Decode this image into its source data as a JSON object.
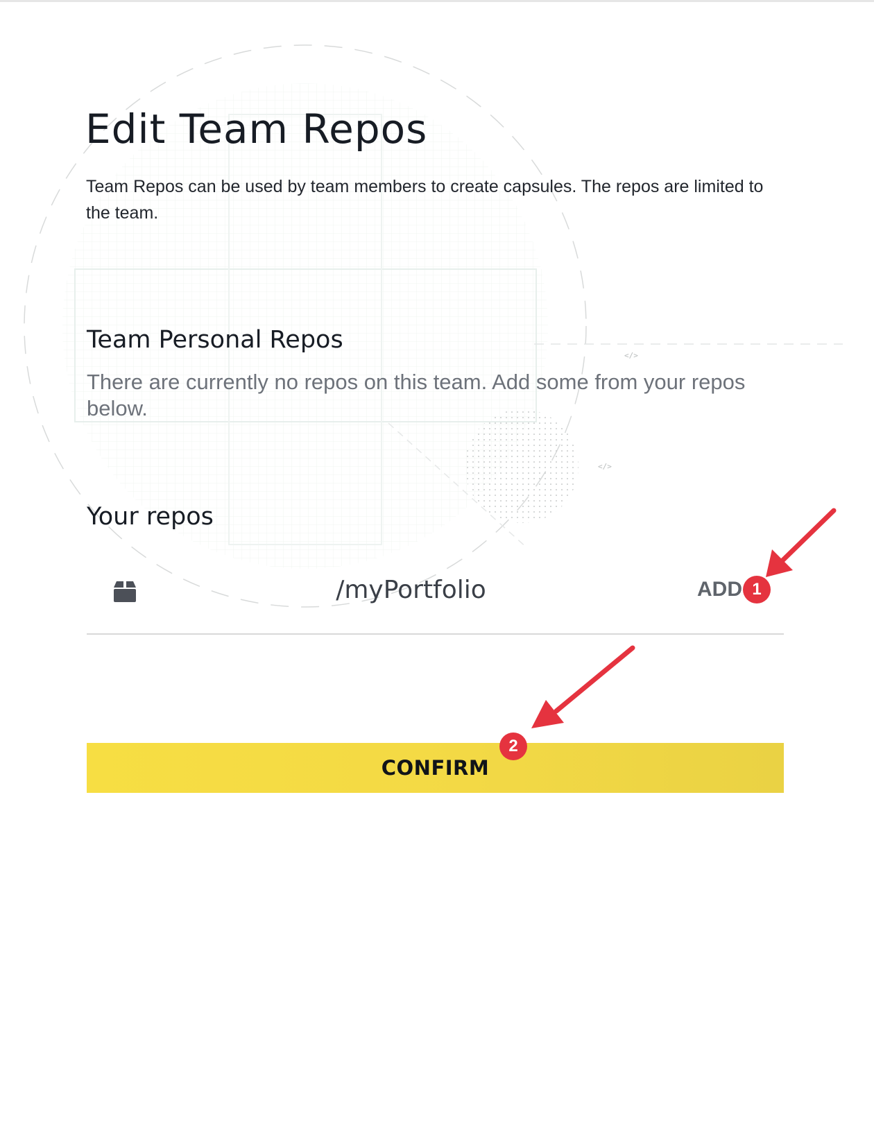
{
  "page": {
    "title": "Edit Team Repos",
    "description": "Team Repos can be used by team members to create capsules. The repos are limited to the team."
  },
  "team_repos": {
    "heading": "Team Personal Repos",
    "empty_message": "There are currently no repos on this team. Add some from your repos below."
  },
  "your_repos": {
    "heading": "Your repos",
    "items": [
      {
        "icon": "box-icon",
        "name": "/myPortfolio",
        "action_label": "ADD"
      }
    ]
  },
  "confirm": {
    "label": "CONFIRM"
  },
  "annotations": {
    "badges": [
      "1",
      "2"
    ],
    "color": "#e5333f"
  },
  "colors": {
    "accent": "#f5db45",
    "text": "#171c24",
    "muted": "#6d727a"
  }
}
